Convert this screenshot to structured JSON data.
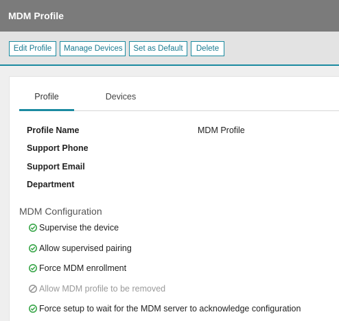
{
  "window": {
    "title": "MDM Profile"
  },
  "toolbar": {
    "edit_label": "Edit Profile",
    "manage_label": "Manage Devices",
    "default_label": "Set as Default",
    "delete_label": "Delete"
  },
  "tabs": [
    {
      "label": "Profile",
      "active": true
    },
    {
      "label": "Devices",
      "active": false
    }
  ],
  "profile": {
    "fields": [
      {
        "label": "Profile Name",
        "value": "MDM Profile"
      },
      {
        "label": "Support Phone",
        "value": ""
      },
      {
        "label": "Support Email",
        "value": ""
      },
      {
        "label": "Department",
        "value": ""
      }
    ]
  },
  "config": {
    "title": "MDM Configuration",
    "options": [
      {
        "label": "Supervise the device",
        "enabled": true,
        "icon": "check-circle-icon"
      },
      {
        "label": "Allow supervised pairing",
        "enabled": true,
        "icon": "check-circle-icon"
      },
      {
        "label": "Force MDM enrollment",
        "enabled": true,
        "icon": "check-circle-icon"
      },
      {
        "label": "Allow MDM profile to be removed",
        "enabled": false,
        "icon": "disabled-circle-icon"
      },
      {
        "label": "Force setup to wait for the MDM server to acknowledge configuration",
        "enabled": true,
        "icon": "check-circle-icon"
      }
    ]
  },
  "colors": {
    "accent": "#1a8aa0",
    "titlebar": "#7b7b7b",
    "check": "#3aa64a",
    "disabled": "#9a9a9a"
  }
}
